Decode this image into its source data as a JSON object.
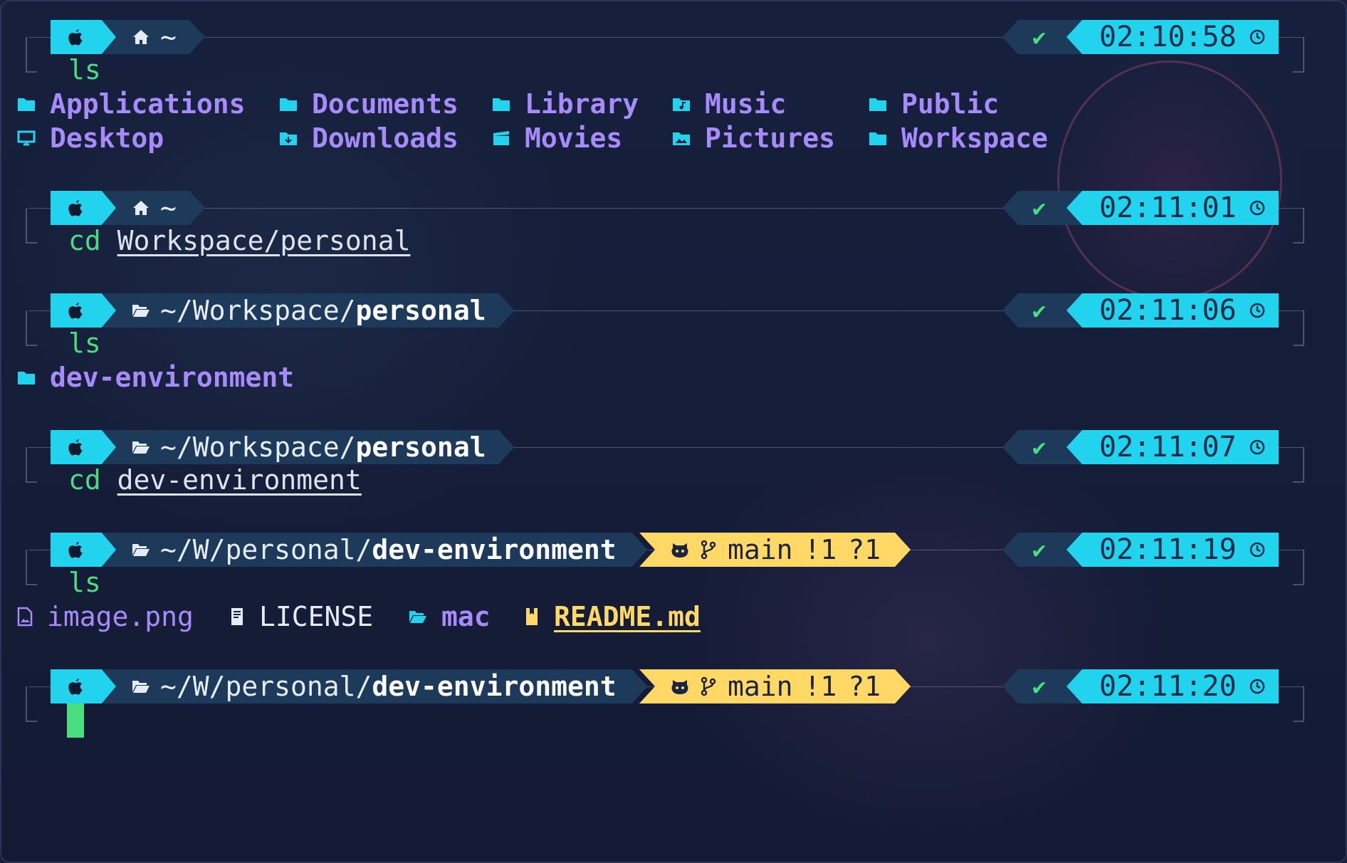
{
  "prompt": {
    "home_symbol": "~"
  },
  "blocks": [
    {
      "dir_short": "~",
      "dir_bold": "",
      "dir_plain": "",
      "time": "02:10:58",
      "command": "ls",
      "arg": ""
    },
    {
      "dir_short": "~",
      "dir_bold": "",
      "dir_plain": "",
      "time": "02:11:01",
      "command": "cd ",
      "arg": "Workspace/personal"
    },
    {
      "dir_short": "",
      "dir_plain": "~/Workspace/",
      "dir_bold": "personal",
      "time": "02:11:06",
      "command": "ls",
      "arg": ""
    },
    {
      "dir_short": "",
      "dir_plain": "~/Workspace/",
      "dir_bold": "personal",
      "time": "02:11:07",
      "command": "cd ",
      "arg": "dev-environment"
    },
    {
      "dir_short": "",
      "dir_plain": "~/W/personal/",
      "dir_bold": "dev-environment",
      "time": "02:11:19",
      "command": "ls",
      "arg": ""
    },
    {
      "dir_short": "",
      "dir_plain": "~/W/personal/",
      "dir_bold": "dev-environment",
      "time": "02:11:20",
      "command": "",
      "arg": ""
    }
  ],
  "git": {
    "branch": "main",
    "modified": "!1",
    "untracked": "?1"
  },
  "status_check": "✔",
  "ls_home": [
    {
      "name": "Applications",
      "icon": "folder-icon"
    },
    {
      "name": "Documents",
      "icon": "folder-icon"
    },
    {
      "name": "Library",
      "icon": "folder-icon"
    },
    {
      "name": "Music",
      "icon": "music-folder-icon"
    },
    {
      "name": "Public",
      "icon": "folder-icon"
    },
    {
      "name": "Desktop",
      "icon": "desktop-icon"
    },
    {
      "name": "Downloads",
      "icon": "download-folder-icon"
    },
    {
      "name": "Movies",
      "icon": "movie-folder-icon"
    },
    {
      "name": "Pictures",
      "icon": "pictures-folder-icon"
    },
    {
      "name": "Workspace",
      "icon": "folder-icon"
    }
  ],
  "ls_personal": [
    {
      "name": "dev-environment",
      "icon": "folder-icon"
    }
  ],
  "ls_dev": [
    {
      "name": "image.png",
      "icon": "image-file-icon"
    },
    {
      "name": "LICENSE",
      "icon": "license-file-icon"
    },
    {
      "name": "mac",
      "icon": "open-folder-icon"
    },
    {
      "name": "README.md",
      "icon": "readme-file-icon"
    }
  ],
  "colors": {
    "accent_cyan": "#22d3ee",
    "segment_dark": "#1e3a5a",
    "git_yellow": "#ffd866",
    "ok_green": "#4ade80",
    "dir_purple": "#a78bfa"
  }
}
